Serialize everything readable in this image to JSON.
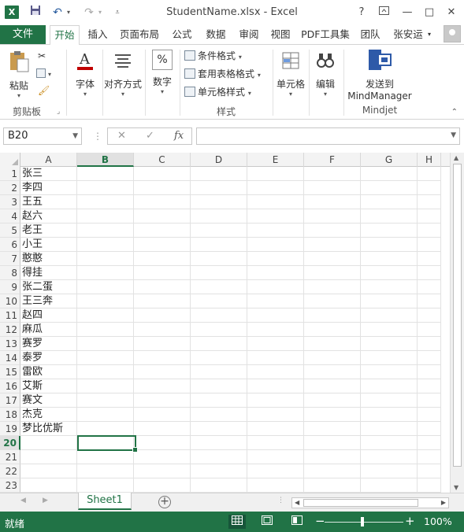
{
  "titlebar": {
    "title": "StudentName.xlsx - Excel",
    "help": "?",
    "ribbon_display": "⊡",
    "minimize": "—",
    "restore": "□",
    "close": "✕",
    "undo": "↶",
    "redo": "↷"
  },
  "tabs": {
    "file": "文件",
    "items": [
      "开始",
      "插入",
      "页面布局",
      "公式",
      "数据",
      "审阅",
      "视图",
      "PDF工具集",
      "团队"
    ],
    "user": "张安运"
  },
  "ribbon": {
    "clipboard": {
      "paste": "粘贴",
      "group": "剪贴板"
    },
    "font": {
      "label": "字体"
    },
    "align": {
      "label": "对齐方式"
    },
    "number": {
      "label": "数字",
      "icon_text": "%"
    },
    "styles": {
      "conditional": "条件格式",
      "table": "套用表格格式",
      "cell": "单元格样式",
      "group": "样式"
    },
    "cells": {
      "label": "单元格"
    },
    "editing": {
      "label": "编辑"
    },
    "mindjet": {
      "line1": "发送到",
      "line2": "MindManager",
      "group": "Mindjet"
    }
  },
  "formula_bar": {
    "name_box": "B20",
    "fx": "fx",
    "cancel": "✕",
    "enter": "✓",
    "value": ""
  },
  "grid": {
    "columns": [
      "A",
      "B",
      "C",
      "D",
      "E",
      "F",
      "G",
      "H"
    ],
    "selected_column": "B",
    "selected_row": 20,
    "rows": [
      {
        "n": 1,
        "a": "张三"
      },
      {
        "n": 2,
        "a": "李四"
      },
      {
        "n": 3,
        "a": "王五"
      },
      {
        "n": 4,
        "a": "赵六"
      },
      {
        "n": 5,
        "a": "老王"
      },
      {
        "n": 6,
        "a": "小王"
      },
      {
        "n": 7,
        "a": "憨憨"
      },
      {
        "n": 8,
        "a": "得挂"
      },
      {
        "n": 9,
        "a": "张二蛋"
      },
      {
        "n": 10,
        "a": "王三奔"
      },
      {
        "n": 11,
        "a": "赵四"
      },
      {
        "n": 12,
        "a": "麻瓜"
      },
      {
        "n": 13,
        "a": "赛罗"
      },
      {
        "n": 14,
        "a": "泰罗"
      },
      {
        "n": 15,
        "a": "雷欧"
      },
      {
        "n": 16,
        "a": "艾斯"
      },
      {
        "n": 17,
        "a": "赛文"
      },
      {
        "n": 18,
        "a": "杰克"
      },
      {
        "n": 19,
        "a": "梦比优斯"
      },
      {
        "n": 20,
        "a": ""
      },
      {
        "n": 21,
        "a": ""
      },
      {
        "n": 22,
        "a": ""
      },
      {
        "n": 23,
        "a": ""
      }
    ]
  },
  "sheets": {
    "active": "Sheet1",
    "add": "+"
  },
  "status": {
    "text": "就绪",
    "zoom": "100%",
    "zoom_minus": "−",
    "zoom_plus": "+"
  },
  "colors": {
    "accent": "#217346",
    "status_bar": "#217346"
  }
}
